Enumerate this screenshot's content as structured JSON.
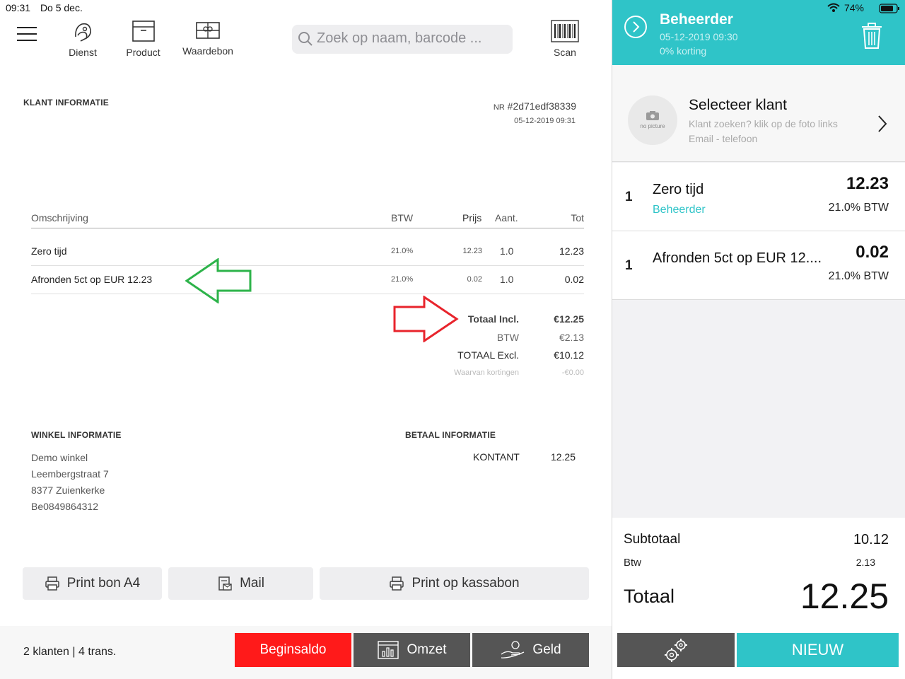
{
  "status": {
    "time": "09:31",
    "date": "Do 5 dec.",
    "battery": "74%"
  },
  "toolbar": {
    "dienst": "Dienst",
    "product": "Product",
    "waardebon": "Waardebon",
    "search_placeholder": "Zoek op naam, barcode ...",
    "scan": "Scan"
  },
  "receipt": {
    "klant_title": "KLANT INFORMATIE",
    "nr_prefix": "NR",
    "nr_value": "#2d71edf38339",
    "datetime": "05-12-2019 09:31",
    "columns": {
      "desc": "Omschrijving",
      "btw": "BTW",
      "prijs": "Prijs",
      "aant": "Aant.",
      "tot": "Tot"
    },
    "rows": [
      {
        "desc": "Zero tijd",
        "btw": "21.0%",
        "prijs": "12.23",
        "aant": "1.0",
        "tot": "12.23"
      },
      {
        "desc": "Afronden 5ct op EUR 12.23",
        "btw": "21.0%",
        "prijs": "0.02",
        "aant": "1.0",
        "tot": "0.02"
      }
    ],
    "totals": {
      "incl_label": "Totaal Incl.",
      "incl_value": "€12.25",
      "btw_label": "BTW",
      "btw_value": "€2.13",
      "excl_label": "TOTAAL Excl.",
      "excl_value": "€10.12",
      "korting_label": "Waarvan kortingen",
      "korting_value": "-€0.00"
    },
    "winkel_title": "WINKEL INFORMATIE",
    "winkel_lines": [
      "Demo winkel",
      "Leembergstraat 7",
      "8377 Zuienkerke",
      "Be0849864312"
    ],
    "betaal_title": "BETAAL INFORMATIE",
    "betaal_method": "KONTANT",
    "betaal_amount": "12.25"
  },
  "actions": {
    "print_a4": "Print bon A4",
    "mail": "Mail",
    "print_kassabon": "Print op kassabon"
  },
  "footer": {
    "summary": "2 klanten | 4 trans.",
    "beginsaldo": "Beginsaldo",
    "omzet": "Omzet",
    "geld": "Geld"
  },
  "cart": {
    "user": "Beheerder",
    "datetime": "05-12-2019 09:30",
    "discount": "0% korting",
    "customer_title": "Selecteer klant",
    "customer_hint": "Klant zoeken? klik op de foto links",
    "customer_contact": "Email - telefoon",
    "avatar_text": "no picture",
    "items": [
      {
        "qty": "1",
        "name": "Zero tijd",
        "sub": "Beheerder",
        "price": "12.23",
        "tax": "21.0% BTW"
      },
      {
        "qty": "1",
        "name": "Afronden 5ct op EUR 12....",
        "sub": "",
        "price": "0.02",
        "tax": "21.0% BTW"
      }
    ],
    "subtotaal_label": "Subtotaal",
    "subtotaal_value": "10.12",
    "btw_label": "Btw",
    "btw_value": "2.13",
    "totaal_label": "Totaal",
    "totaal_value": "12.25",
    "nieuw": "NIEUW"
  },
  "colors": {
    "accent": "#2fc4c8",
    "red": "#ff1a1a",
    "dark_button": "#555555",
    "green_arrow": "#2db34a",
    "red_arrow": "#e8242c"
  }
}
